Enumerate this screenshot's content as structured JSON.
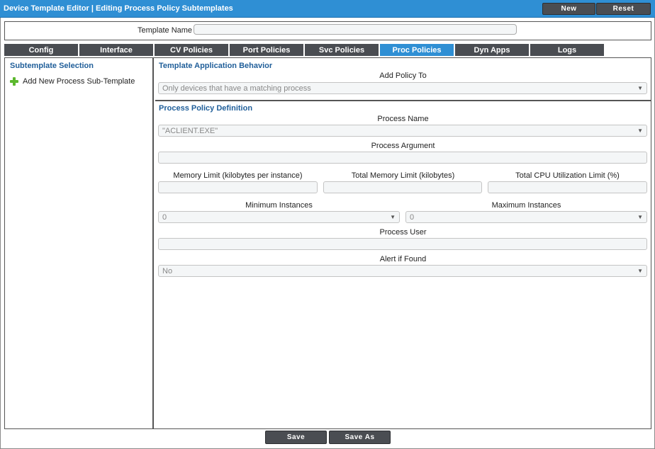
{
  "window": {
    "title": "Device Template Editor | Editing Process Policy Subtemplates",
    "new_label": "New",
    "reset_label": "Reset"
  },
  "template_name": {
    "label": "Template Name",
    "value": ""
  },
  "tabs": [
    {
      "label": "Config",
      "active": false
    },
    {
      "label": "Interface",
      "active": false
    },
    {
      "label": "CV Policies",
      "active": false
    },
    {
      "label": "Port Policies",
      "active": false
    },
    {
      "label": "Svc Policies",
      "active": false
    },
    {
      "label": "Proc Policies",
      "active": true
    },
    {
      "label": "Dyn Apps",
      "active": false
    },
    {
      "label": "Logs",
      "active": false
    }
  ],
  "subtemplate_selection": {
    "heading": "Subtemplate Selection",
    "add_label": "Add New Process Sub-Template",
    "add_icon": "plus-icon"
  },
  "behavior": {
    "heading": "Template Application Behavior",
    "add_policy_label": "Add Policy To",
    "add_policy_value": "Only devices that have a matching process"
  },
  "definition": {
    "heading": "Process Policy Definition",
    "process_name_label": "Process Name",
    "process_name_value": "\"ACLIENT.EXE\"",
    "process_argument_label": "Process Argument",
    "memory_limit_label": "Memory Limit (kilobytes per instance)",
    "total_memory_label": "Total Memory Limit (kilobytes)",
    "cpu_limit_label": "Total CPU Utilization Limit (%)",
    "min_instances_label": "Minimum Instances",
    "min_instances_value": "0",
    "max_instances_label": "Maximum Instances",
    "max_instances_value": "0",
    "process_user_label": "Process User",
    "alert_label": "Alert if Found",
    "alert_value": "No"
  },
  "footer": {
    "save_label": "Save",
    "save_as_label": "Save As"
  }
}
